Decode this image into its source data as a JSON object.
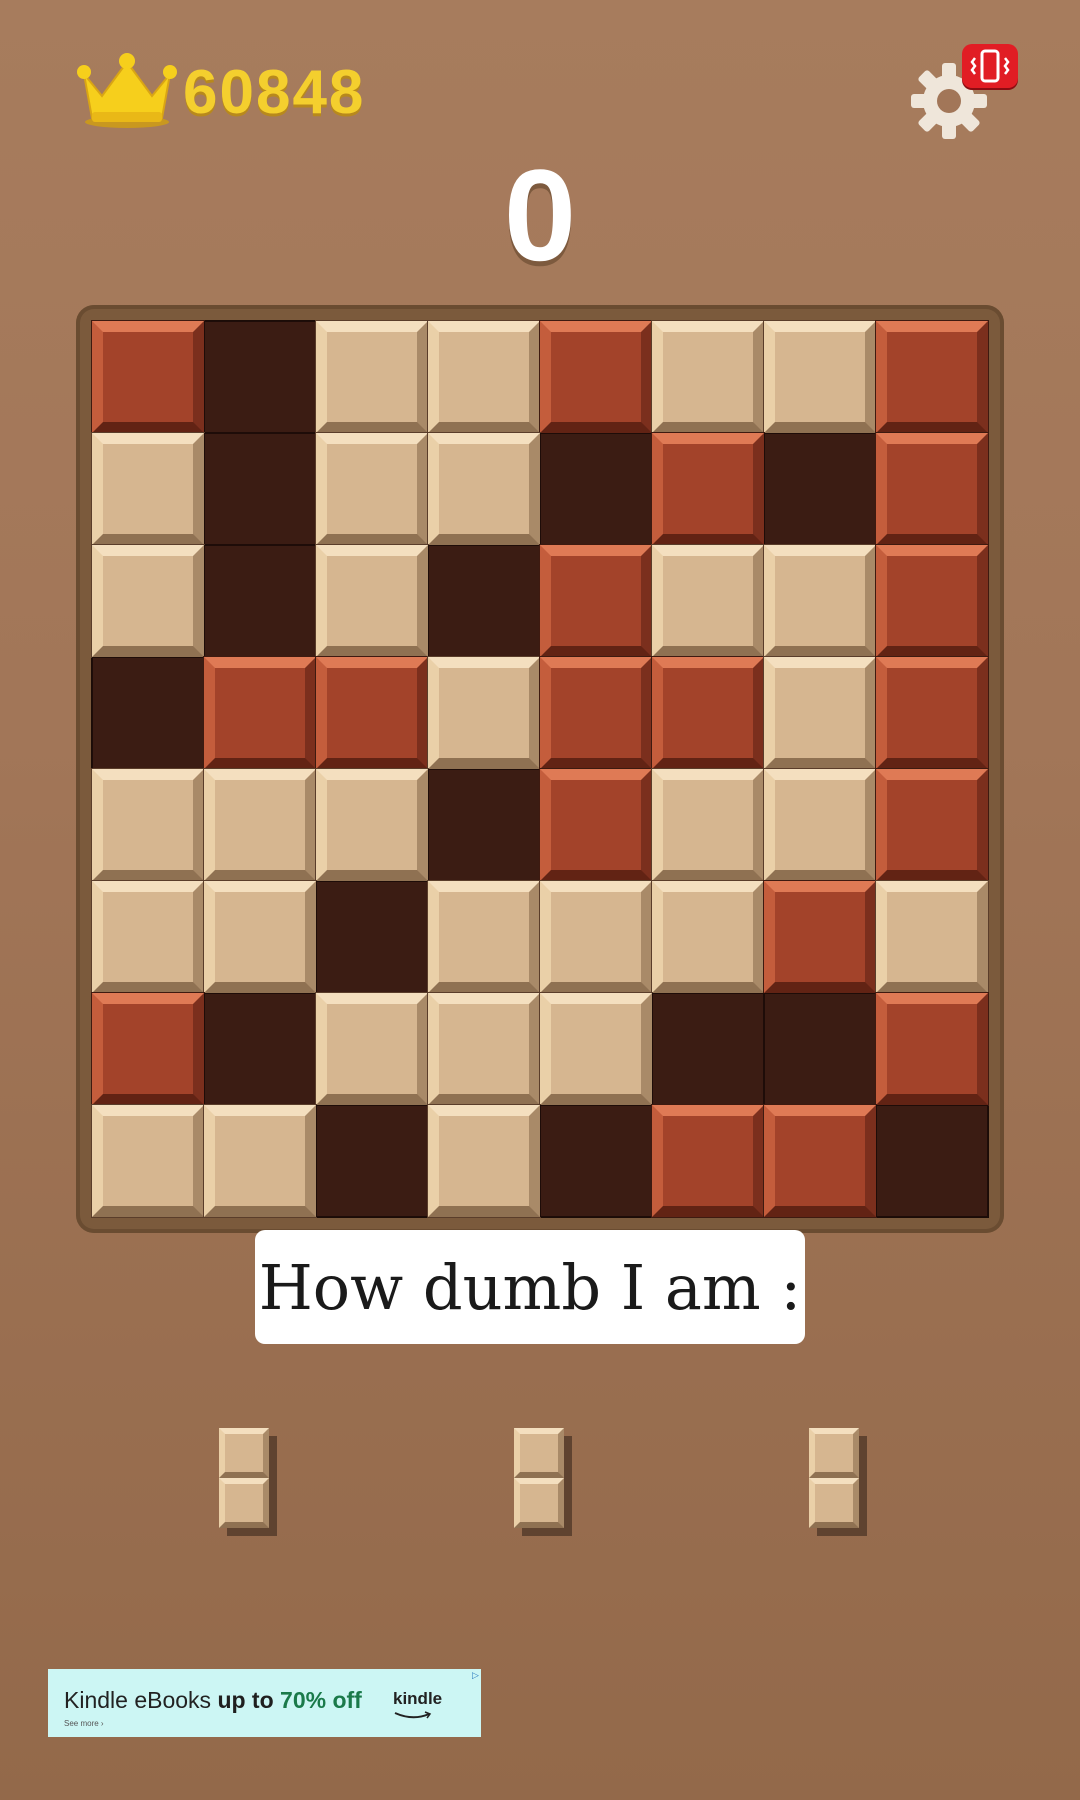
{
  "header": {
    "best_score": "60848",
    "current_score": "0",
    "crown_icon": "crown-icon",
    "settings_icon": "gear-icon",
    "vibrate_icon": "phone-vibrate-icon"
  },
  "board": {
    "size": 8,
    "rows": [
      [
        "dark",
        "empty",
        "light",
        "light",
        "dark",
        "light",
        "light",
        "dark"
      ],
      [
        "light",
        "empty",
        "light",
        "light",
        "empty",
        "dark",
        "empty",
        "dark"
      ],
      [
        "light",
        "empty",
        "light",
        "empty",
        "dark",
        "light",
        "light",
        "dark"
      ],
      [
        "empty",
        "dark",
        "dark",
        "light",
        "dark",
        "dark",
        "light",
        "dark"
      ],
      [
        "light",
        "light",
        "light",
        "empty",
        "dark",
        "light",
        "light",
        "dark"
      ],
      [
        "light",
        "light",
        "empty",
        "light",
        "light",
        "light",
        "dark",
        "light"
      ],
      [
        "dark",
        "empty",
        "light",
        "light",
        "light",
        "empty",
        "empty",
        "dark"
      ],
      [
        "light",
        "light",
        "empty",
        "light",
        "empty",
        "dark",
        "dark",
        "empty"
      ]
    ]
  },
  "caption": {
    "text": "How dumb I am :"
  },
  "pieces": [
    {
      "shape": "vertical-2",
      "color": "light"
    },
    {
      "shape": "vertical-2",
      "color": "light"
    },
    {
      "shape": "vertical-2",
      "color": "light"
    }
  ],
  "ad": {
    "text_prefix": "Kindle eBooks ",
    "text_highlight": "up to ",
    "text_percent": "70% off",
    "see_more": "See more ›",
    "brand": "kindle",
    "adchoices": "▷"
  },
  "colors": {
    "background": "#a27658",
    "best_score": "#f4cf2e",
    "block_light": "#d6b690",
    "block_dark": "#a3432a",
    "empty_cell": "#3b1c13",
    "vibrate_badge": "#e11d24"
  }
}
